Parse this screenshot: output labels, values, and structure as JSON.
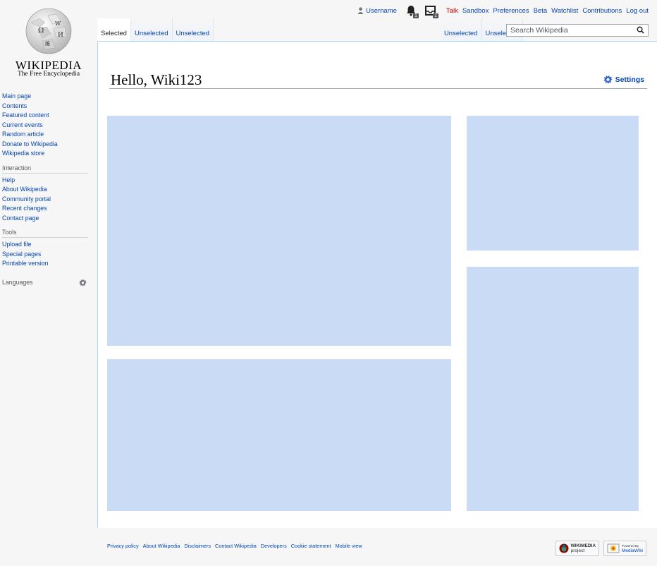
{
  "logo": {
    "title": "WIKIPEDIA",
    "subtitle": "The Free Encyclopedia"
  },
  "personal_tools": {
    "username": "Username",
    "alerts_count": "1",
    "notices_count": "1",
    "talk": "Talk",
    "links": [
      "Sandbox",
      "Preferences",
      "Beta",
      "Watchlist",
      "Contributions",
      "Log out"
    ]
  },
  "tabs_left": [
    "Selected",
    "Unselected",
    "Unselected"
  ],
  "tabs_right": [
    "Unselected",
    "Unselected"
  ],
  "search": {
    "placeholder": "Search Wikipedia"
  },
  "page": {
    "heading": "Hello, Wiki123",
    "settings_label": "Settings"
  },
  "sidebar": {
    "navigation": [
      "Main page",
      "Contents",
      "Featured content",
      "Current events",
      "Random article",
      "Donate to Wikipedia",
      "Wikipedia store"
    ],
    "interaction": {
      "heading": "Interaction",
      "items": [
        "Help",
        "About Wikipedia",
        "Community portal",
        "Recent changes",
        "Contact page"
      ]
    },
    "tools": {
      "heading": "Tools",
      "items": [
        "Upload file",
        "Special pages",
        "Printable version"
      ]
    },
    "languages": {
      "heading": "Languages"
    }
  },
  "footer": {
    "links": [
      "Privacy policy",
      "About Wikipedia",
      "Disclaimers",
      "Contact Wikipedia",
      "Developers",
      "Cookie statement",
      "Mobile view"
    ],
    "wikimedia_badge": "WIKIMEDIA",
    "wikimedia_badge_sub": "project",
    "mediawiki_badge_top": "Powered By",
    "mediawiki_badge": "MediaWiki"
  },
  "colors": {
    "link": "#0645ad",
    "talk": "#ba0000",
    "placeholder_block": "#c9dbf5",
    "border": "#a7d7f9"
  }
}
